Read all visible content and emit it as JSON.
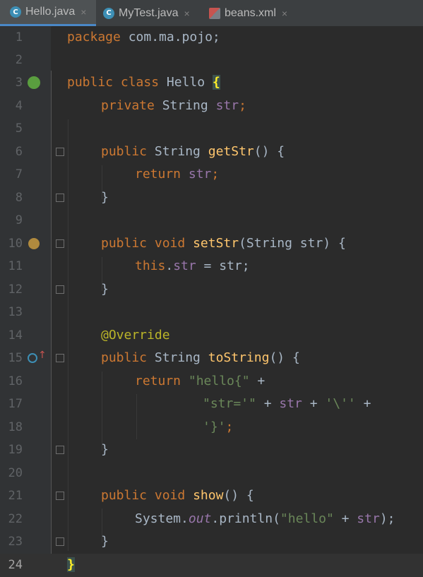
{
  "tabs": [
    {
      "label": "Hello.java",
      "icon": "java-class-icon",
      "active": true
    },
    {
      "label": "MyTest.java",
      "icon": "java-class-run-icon",
      "active": false
    },
    {
      "label": "beans.xml",
      "icon": "xml-file-icon",
      "active": false
    }
  ],
  "close_glyph": "×",
  "current_line": 24,
  "lines": [
    {
      "n": "1"
    },
    {
      "n": "2"
    },
    {
      "n": "3"
    },
    {
      "n": "4"
    },
    {
      "n": "5"
    },
    {
      "n": "6"
    },
    {
      "n": "7"
    },
    {
      "n": "8"
    },
    {
      "n": "9"
    },
    {
      "n": "10"
    },
    {
      "n": "11"
    },
    {
      "n": "12"
    },
    {
      "n": "13"
    },
    {
      "n": "14"
    },
    {
      "n": "15"
    },
    {
      "n": "16"
    },
    {
      "n": "17"
    },
    {
      "n": "18"
    },
    {
      "n": "19"
    },
    {
      "n": "20"
    },
    {
      "n": "21"
    },
    {
      "n": "22"
    },
    {
      "n": "23"
    },
    {
      "n": "24"
    }
  ],
  "code": {
    "l1_kw": "package",
    "l1_rest": " com.ma.pojo;",
    "l3_kw": "public class",
    "l3_name": " Hello ",
    "l3_brace": "{",
    "l4_kw": "private",
    "l4_type": " String ",
    "l4_field": "str",
    "l4_semi": ";",
    "l6_kw": "public",
    "l6_type": " String ",
    "l6_fn": "getStr",
    "l6_rest": "() {",
    "l7_kw": "return",
    "l7_sp": " ",
    "l7_field": "str",
    "l7_semi": ";",
    "l8": "}",
    "l10_kw": "public void",
    "l10_sp": " ",
    "l10_fn": "setStr",
    "l10_rest": "(String str) {",
    "l11_kw": "this",
    "l11_dot": ".",
    "l11_field": "str",
    "l11_rest": " = str;",
    "l12": "}",
    "l14_ann": "@Override",
    "l15_kw": "public",
    "l15_type": " String ",
    "l15_fn": "toString",
    "l15_rest": "() {",
    "l16_kw": "return",
    "l16_sp": " ",
    "l16_str": "\"hello{\"",
    "l16_rest": " +",
    "l17_str1": "\"str='\"",
    "l17_op1": " + ",
    "l17_field": "str",
    "l17_op2": " + ",
    "l17_str2": "'\\''",
    "l17_op3": " +",
    "l18_str": "'}'",
    "l18_semi": ";",
    "l19": "}",
    "l21_kw": "public void",
    "l21_sp": " ",
    "l21_fn": "show",
    "l21_rest": "() {",
    "l22_a": "System.",
    "l22_out": "out",
    "l22_b": ".println(",
    "l22_str": "\"hello\"",
    "l22_c": " + ",
    "l22_field": "str",
    "l22_d": ");",
    "l23": "}",
    "l24": "}"
  },
  "gutter_icons": {
    "line3": "spring-bean-icon",
    "line10": "property-setter-icon",
    "line15": "override-method-icon"
  },
  "colors": {
    "keyword": "#cc7832",
    "field": "#9876aa",
    "method": "#ffc66d",
    "string": "#6a8759",
    "annotation": "#bbb529",
    "text": "#a9b7c6",
    "background": "#2b2b2b"
  }
}
